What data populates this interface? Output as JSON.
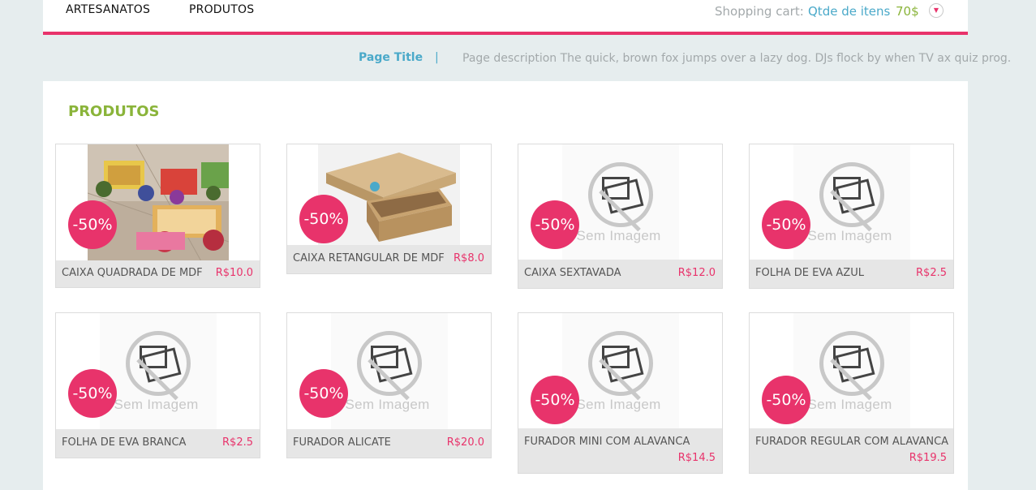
{
  "nav": {
    "items": [
      "ARTESANATOS",
      "PRODUTOS"
    ]
  },
  "cart": {
    "label": "Shopping cart:",
    "items_text": "Qtde de itens",
    "price": "70$",
    "toggle_icon": "chevron-down-icon"
  },
  "header": {
    "page_title": "Page Title",
    "separator": "|",
    "page_description": "Page description The quick, brown fox jumps over a lazy dog. DJs flock by when TV ax quiz prog."
  },
  "section": {
    "title": "PRODUTOS"
  },
  "products": [
    {
      "name": "CAIXA QUADRADA DE MDF",
      "price": "R$10.0",
      "discount": "-50%",
      "image": "photo-toy-carts"
    },
    {
      "name": "CAIXA RETANGULAR DE MDF",
      "price": "R$8.0",
      "discount": "-50%",
      "image": "photo-mdf-box"
    },
    {
      "name": "CAIXA SEXTAVADA",
      "price": "R$12.0",
      "discount": "-50%",
      "image": "no-image"
    },
    {
      "name": "FOLHA DE EVA AZUL",
      "price": "R$2.5",
      "discount": "-50%",
      "image": "no-image"
    },
    {
      "name": "FOLHA DE EVA BRANCA",
      "price": "R$2.5",
      "discount": "-50%",
      "image": "no-image"
    },
    {
      "name": "FURADOR ALICATE",
      "price": "R$20.0",
      "discount": "-50%",
      "image": "no-image"
    },
    {
      "name": "FURADOR MINI COM ALAVANCA",
      "price": "R$14.5",
      "discount": "-50%",
      "image": "no-image"
    },
    {
      "name": "FURADOR REGULAR COM ALAVANCA",
      "price": "R$19.5",
      "discount": "-50%",
      "image": "no-image"
    }
  ],
  "placeholder_text": "Sem Imagem",
  "colors": {
    "accent_pink": "#e8336b",
    "link_blue": "#4aa9c9",
    "green": "#8ab43a",
    "muted_gray": "#a3a9ab"
  }
}
